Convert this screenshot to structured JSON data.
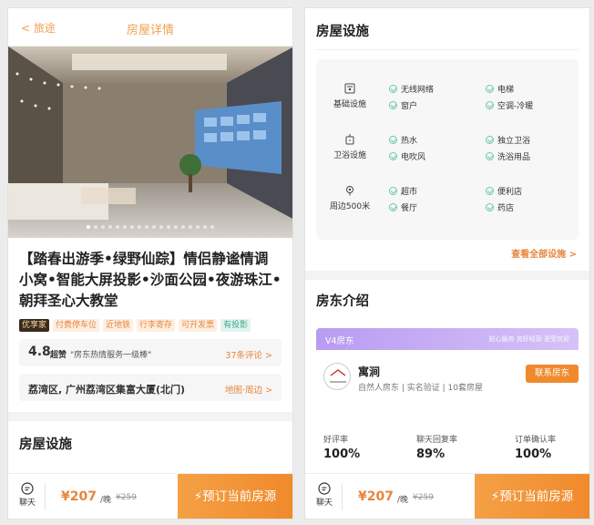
{
  "left": {
    "header": {
      "back_label": "旅途",
      "title": "房屋详情"
    },
    "photo": {
      "dot_count": 18,
      "active_dot": 1
    },
    "listing_title": "【踏春出游季•绿野仙踪】情侣静谧情调小窝•智能大屏投影•沙面公园•夜游珠江•朝拜圣心大教堂",
    "tags": [
      {
        "text": "优享家",
        "style": "dark"
      },
      {
        "text": "付费停车位",
        "style": "orange"
      },
      {
        "text": "近地铁",
        "style": "orange"
      },
      {
        "text": "行李寄存",
        "style": "orange"
      },
      {
        "text": "可开发票",
        "style": "orange"
      },
      {
        "text": "有投影",
        "style": "green"
      }
    ],
    "rating": {
      "score": "4.8",
      "word": "超赞",
      "quote": "\"房东热情服务一级棒\"",
      "reviews_link": "37条评论 >"
    },
    "address": {
      "text": "荔湾区, 广州荔湾区集富大厦(北门)",
      "link": "地图·周边 >"
    },
    "facilities_heading": "房屋设施",
    "bottom_bar": {
      "chat_label": "聊天",
      "price": "¥207",
      "per_night": "/晚",
      "original_price": "¥259",
      "book_label": "预订当前房源"
    }
  },
  "right": {
    "facilities_heading": "房屋设施",
    "facility_groups": [
      {
        "category": "基础设施",
        "icon": "router-icon",
        "items": [
          "无线网络",
          "电梯",
          "窗户",
          "空调-冷暖"
        ]
      },
      {
        "category": "卫浴设施",
        "icon": "shower-icon",
        "items": [
          "热水",
          "独立卫浴",
          "电吹风",
          "洗浴用品"
        ]
      },
      {
        "category": "周边500米",
        "icon": "location-icon",
        "items": [
          "超市",
          "便利店",
          "餐厅",
          "药店"
        ]
      }
    ],
    "see_all_label": "查看全部设施 >",
    "host_heading": "房东介绍",
    "host_banner": {
      "level": "V4房东",
      "slogan": "贴心服务·良好经营·更受欢迎"
    },
    "host": {
      "name": "寓涧",
      "avatar_text": "寓涧",
      "description": "自然人房东 | 实名验证 | 10套房屋",
      "contact_label": "联系房东"
    },
    "stats": [
      {
        "label": "好评率",
        "value": "100%"
      },
      {
        "label": "聊天回复率",
        "value": "89%"
      },
      {
        "label": "订单确认率",
        "value": "100%"
      }
    ],
    "bottom_bar": {
      "chat_label": "聊天",
      "price": "¥207",
      "per_night": "/晚",
      "original_price": "¥259",
      "book_label": "预订当前房源"
    }
  },
  "colors": {
    "accent": "#f08a2c",
    "accent_light": "#f0a050",
    "check_green": "#6cc7a8",
    "vip_purple": "#b89cf2"
  }
}
